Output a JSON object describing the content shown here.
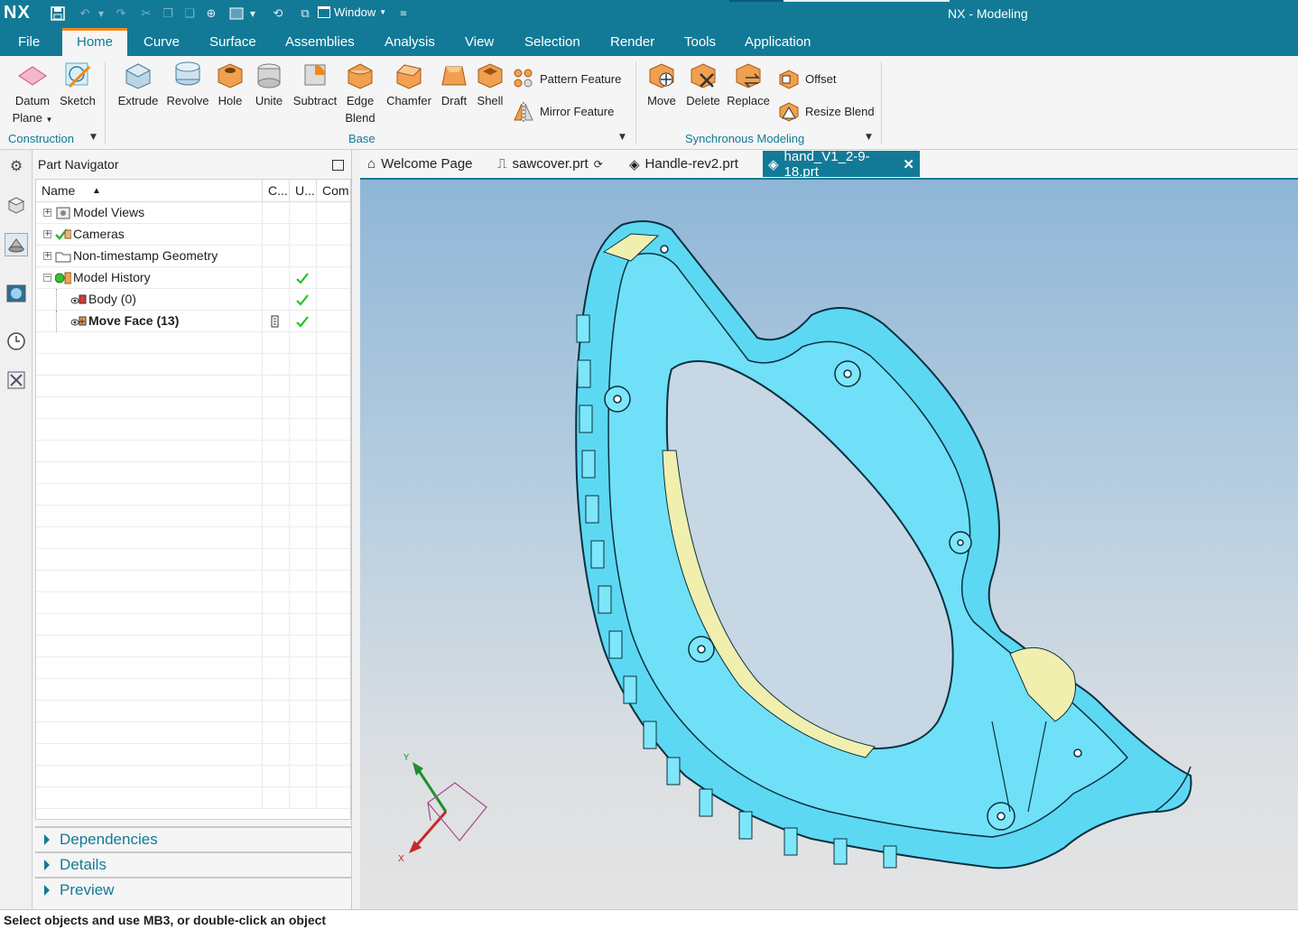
{
  "app": {
    "logo": "NX",
    "window_title": "NX - Modeling",
    "window_menu": "Window",
    "accent": "#127a97",
    "highlight": "#f08a1c"
  },
  "menu": {
    "file": "File",
    "home": "Home",
    "curve": "Curve",
    "surface": "Surface",
    "assemblies": "Assemblies",
    "analysis": "Analysis",
    "view": "View",
    "selection": "Selection",
    "render": "Render",
    "tools": "Tools",
    "application": "Application"
  },
  "ribbon": {
    "datum_plane_1": "Datum",
    "datum_plane_2": "Plane",
    "sketch": "Sketch",
    "extrude": "Extrude",
    "revolve": "Revolve",
    "hole": "Hole",
    "unite": "Unite",
    "subtract": "Subtract",
    "edge_blend_1": "Edge",
    "edge_blend_2": "Blend",
    "chamfer": "Chamfer",
    "draft": "Draft",
    "shell": "Shell",
    "pattern_feature": "Pattern Feature",
    "mirror_feature": "Mirror Feature",
    "move": "Move",
    "delete": "Delete",
    "replace": "Replace",
    "offset": "Offset",
    "resize_blend": "Resize Blend",
    "group_construction": "Construction",
    "group_base": "Base",
    "group_sync": "Synchronous Modeling"
  },
  "navigator": {
    "title": "Part Navigator",
    "col_name": "Name",
    "col_c": "C...",
    "col_u": "U...",
    "col_com": "Com",
    "rows": [
      {
        "label": "Model Views"
      },
      {
        "label": "Cameras"
      },
      {
        "label": "Non-timestamp Geometry"
      },
      {
        "label": "Model History"
      },
      {
        "label": "Body (0)"
      },
      {
        "label": "Move Face (13)"
      }
    ],
    "sections": {
      "dependencies": "Dependencies",
      "details": "Details",
      "preview": "Preview"
    }
  },
  "tabs": {
    "welcome": "Welcome Page",
    "sawcover": "sawcover.prt",
    "handle": "Handle-rev2.prt",
    "hand": "hand_V1_2-9-18.prt"
  },
  "triad": {
    "y": "Y",
    "x": "X"
  },
  "status": {
    "text": "Select objects and use MB3, or double-click an object"
  }
}
